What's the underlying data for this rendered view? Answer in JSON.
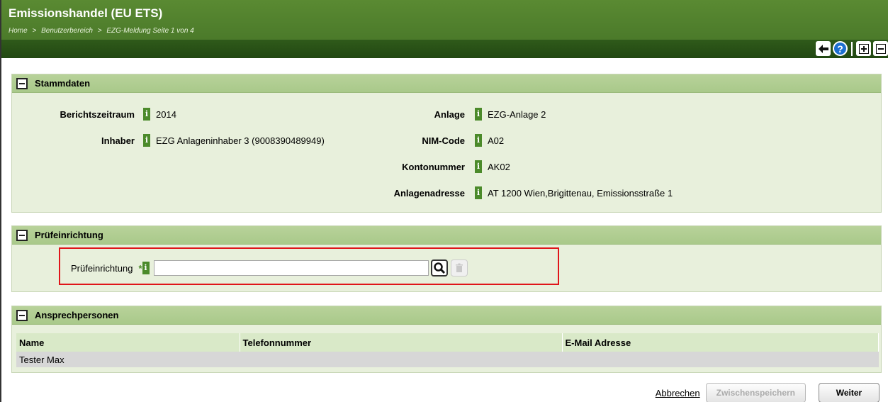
{
  "app": {
    "title": "Emissionshandel (EU ETS)",
    "breadcrumb": [
      "Home",
      ">",
      "Benutzerbereich",
      ">",
      "EZG-Meldung Seite 1 von 4"
    ]
  },
  "toolbar": {
    "icons": [
      "back-arrow-icon",
      "help-icon",
      "expand-all-icon",
      "collapse-all-icon"
    ]
  },
  "stammdaten": {
    "title": "Stammdaten",
    "left": [
      {
        "label": "Berichtszeitraum",
        "value": "2014"
      },
      {
        "label": "Inhaber",
        "value": "EZG Anlageninhaber 3 (9008390489949)"
      }
    ],
    "right": [
      {
        "label": "Anlage",
        "value": "EZG-Anlage 2"
      },
      {
        "label": "NIM-Code",
        "value": "A02"
      },
      {
        "label": "Kontonummer",
        "value": "AK02"
      },
      {
        "label": "Anlagenadresse",
        "value": "AT 1200 Wien,Brigittenau, Emissionsstraße 1"
      }
    ]
  },
  "pruefeinrichtung": {
    "title": "Prüfeinrichtung",
    "field_label": "Prüfeinrichtung",
    "required_marker": "*",
    "value": ""
  },
  "ansprechpersonen": {
    "title": "Ansprechpersonen",
    "columns": [
      "Name",
      "Telefonnummer",
      "E-Mail Adresse"
    ],
    "rows": [
      [
        "Tester Max",
        "",
        ""
      ]
    ]
  },
  "footer": {
    "cancel_label": "Abbrechen",
    "save_label": "Zwischenspeichern",
    "next_label": "Weiter"
  },
  "colors": {
    "header_green": "#4b7a2a",
    "toolbar_green": "#2f5a1a",
    "panel_head": "#b8d29a",
    "panel_body": "#e8f0dc",
    "highlight_red": "#e0151a"
  }
}
